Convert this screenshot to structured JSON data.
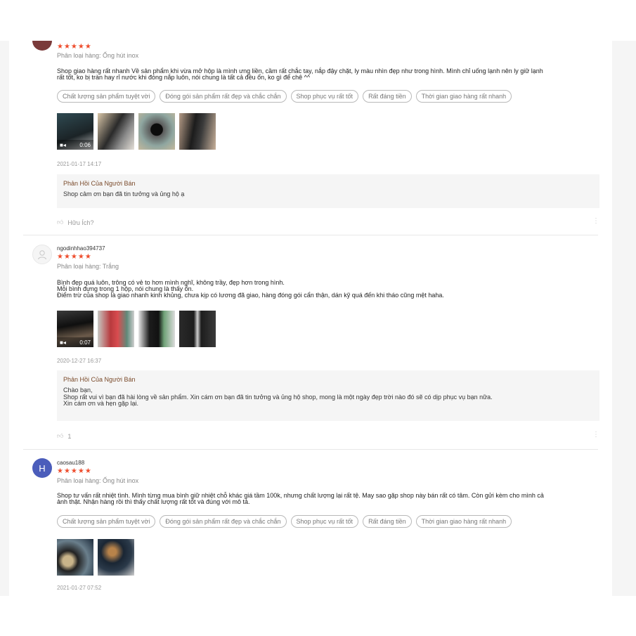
{
  "reviews": [
    {
      "username": "",
      "stars": "★★★★★",
      "variant": "Phân loại hàng: Ống hút inox",
      "text": "Shop giao hàng rất nhanh Về sản phẩm khi vừa mở hộp là mình ưng liền, cầm rất chắc tay, nắp đậy chặt, ly màu nhìn đẹp như trong hình. Mình chỉ uống lạnh nên ly giữ lạnh\nrất tốt,  ko bị tràn hay rỉ nước khi đóng nắp luôn, nói chung là tất cả đều ổn, ko gì để chê ^^",
      "tags": [
        "Chất lượng sản phẩm tuyệt vời",
        "Đóng gói sản phẩm rất đẹp và chắc chắn",
        "Shop phục vụ rất tốt",
        "Rất đáng tiền",
        "Thời gian giao hàng rất nhanh"
      ],
      "video_duration": "0:06",
      "date": "2021-01-17 14:17",
      "seller_title": "Phản Hồi Của Người Bán",
      "seller_text": "Shop cảm ơn bạn đã tin tưởng và ủng hộ ạ",
      "helpful": "Hữu Ích?"
    },
    {
      "username": "ngodinhhao394737",
      "stars": "★★★★★",
      "variant": "Phân loại hàng: Trắng",
      "text": "Bình đẹp quá luôn, trông có vẻ to hơn mình nghĩ, không trầy, đẹp hơn trong hình.\nMỗi bình đựng trong 1 hộp, nói chung là thấy ổn.\nĐiểm trừ của shop là giao nhanh kinh khủng, chưa kịp có lương đã giao, hàng đóng gói cẩn thận, dán kỹ quá đến khi tháo cũng mệt haha.",
      "video_duration": "0:07",
      "date": "2020-12-27 16:37",
      "seller_title": "Phản Hồi Của Người Bán",
      "seller_text": "Chào bạn,\nShop rất vui vì bạn đã hài lòng về sản phẩm. Xin cám ơn bạn đã tin tưởng và ủng hộ shop, mong là một ngày đẹp trời nào đó sẽ có dịp phục vụ bạn nữa.\nXin cám ơn và hẹn gặp lại.",
      "helpful": "1"
    },
    {
      "username": "caosau188",
      "avatar_letter": "H",
      "stars": "★★★★★",
      "variant": "Phân loại hàng: Ống hút inox",
      "text": "Shop tư vấn rất nhiệt tình. Mình từng mua bình giữ nhiệt chỗ khác giá tầm 100k, nhưng chất lượng lại rất tệ. May sao gặp shop này bán rất có tâm. Còn gửi kèm cho mình cả\nảnh thật. Nhận hàng rồi thì thấy chất lượng rất tốt và đúng với mô tả.",
      "tags": [
        "Chất lượng sản phẩm tuyệt vời",
        "Đóng gói sản phẩm rất đẹp và chắc chắn",
        "Shop phục vụ rất tốt",
        "Rất đáng tiền",
        "Thời gian giao hàng rất nhanh"
      ],
      "date": "2021-01-27 07:52"
    }
  ],
  "colors": {
    "star": "#ee4d2d",
    "avatar": "#4b5dbb",
    "seller_title": "#7a4a2a"
  },
  "icons": [
    "thumbs-up-icon",
    "more-icon",
    "video-camera-icon",
    "user-placeholder-icon"
  ]
}
